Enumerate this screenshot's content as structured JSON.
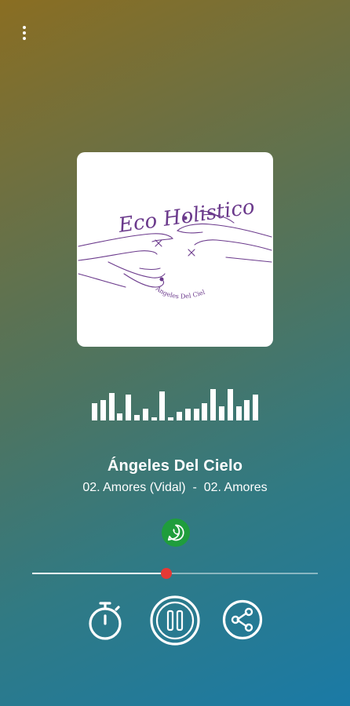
{
  "player": {
    "station_name": "Ángeles Del Cielo",
    "track_primary": "02. Amores (Vidal)",
    "separator": "  -  ",
    "track_secondary": "02. Amores",
    "progress_fraction": 0.47,
    "progress_color": "#e53935"
  },
  "artwork": {
    "logo_script_text": "Eco Holistico",
    "logo_caption": "Ángeles Del Cielo",
    "logo_color": "#6b3a8c"
  },
  "visualizer": {
    "levels": [
      0.5,
      0.6,
      0.8,
      0.2,
      0.75,
      0.15,
      0.35,
      0.1,
      0.85,
      0.1,
      0.25,
      0.35,
      0.35,
      0.5,
      0.9,
      0.4,
      0.9,
      0.4,
      0.6,
      0.75
    ]
  },
  "icons": {
    "menu": "more-vert-icon",
    "whatsapp": "whatsapp-icon",
    "timer": "timer-icon",
    "pause": "pause-icon",
    "share": "share-icon"
  }
}
